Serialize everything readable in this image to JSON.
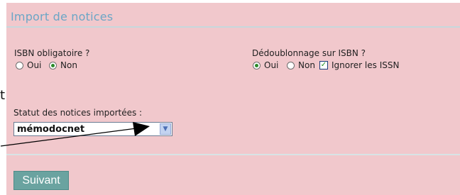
{
  "panel": {
    "title": "Import de notices"
  },
  "isbn_required": {
    "label": "ISBN obligatoire ?",
    "options": [
      {
        "label": "Oui",
        "checked": false
      },
      {
        "label": "Non",
        "checked": true
      }
    ]
  },
  "dedup": {
    "label": "Dédoublonnage sur ISBN ?",
    "options": [
      {
        "label": "Oui",
        "checked": true
      },
      {
        "label": "Non",
        "checked": false
      }
    ],
    "ignore_issn": {
      "label": "Ignorer les ISSN",
      "checked": true
    }
  },
  "status": {
    "label": "Statut des notices importées :",
    "selected": "mémodocnet",
    "arrow": "▼"
  },
  "edge_text": "t",
  "next_button": {
    "label": "Suivant"
  },
  "colors": {
    "panel_bg": "#f1c8cc",
    "title": "#6ba6c6",
    "button_bg": "#6aa3a0",
    "radio_check": "#2a8a2a"
  }
}
